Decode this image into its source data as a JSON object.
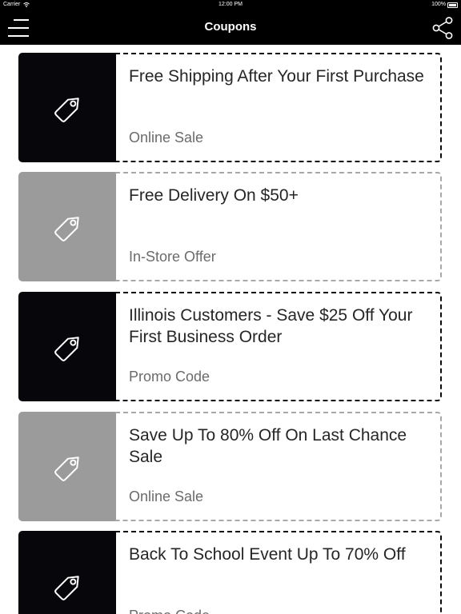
{
  "status_bar": {
    "carrier": "Carrier",
    "time": "12:00 PM",
    "battery": "100%"
  },
  "nav": {
    "title": "Coupons",
    "menu_icon": "hamburger-menu-icon",
    "share_icon": "share-icon"
  },
  "colors": {
    "dark_panel": "#07060b",
    "light_panel": "#9b9b9b",
    "dark_dash": "#0b0b0f",
    "light_dash": "#a8a8a8"
  },
  "coupons": [
    {
      "title": "Free Shipping After Your First Purchase",
      "type": "Online Sale",
      "style": "dark",
      "icon": "tag-icon"
    },
    {
      "title": "Free Delivery On $50+",
      "type": "In-Store Offer",
      "style": "light",
      "icon": "tag-icon"
    },
    {
      "title": "Illinois Customers - Save $25 Off Your First Business Order",
      "type": "Promo Code",
      "style": "dark",
      "icon": "tag-icon"
    },
    {
      "title": "Save Up To 80% Off On Last Chance Sale",
      "type": "Online Sale",
      "style": "light",
      "icon": "tag-icon"
    },
    {
      "title": "Back To School Event Up To 70% Off",
      "type": "Promo Code",
      "style": "dark",
      "icon": "tag-icon"
    }
  ]
}
